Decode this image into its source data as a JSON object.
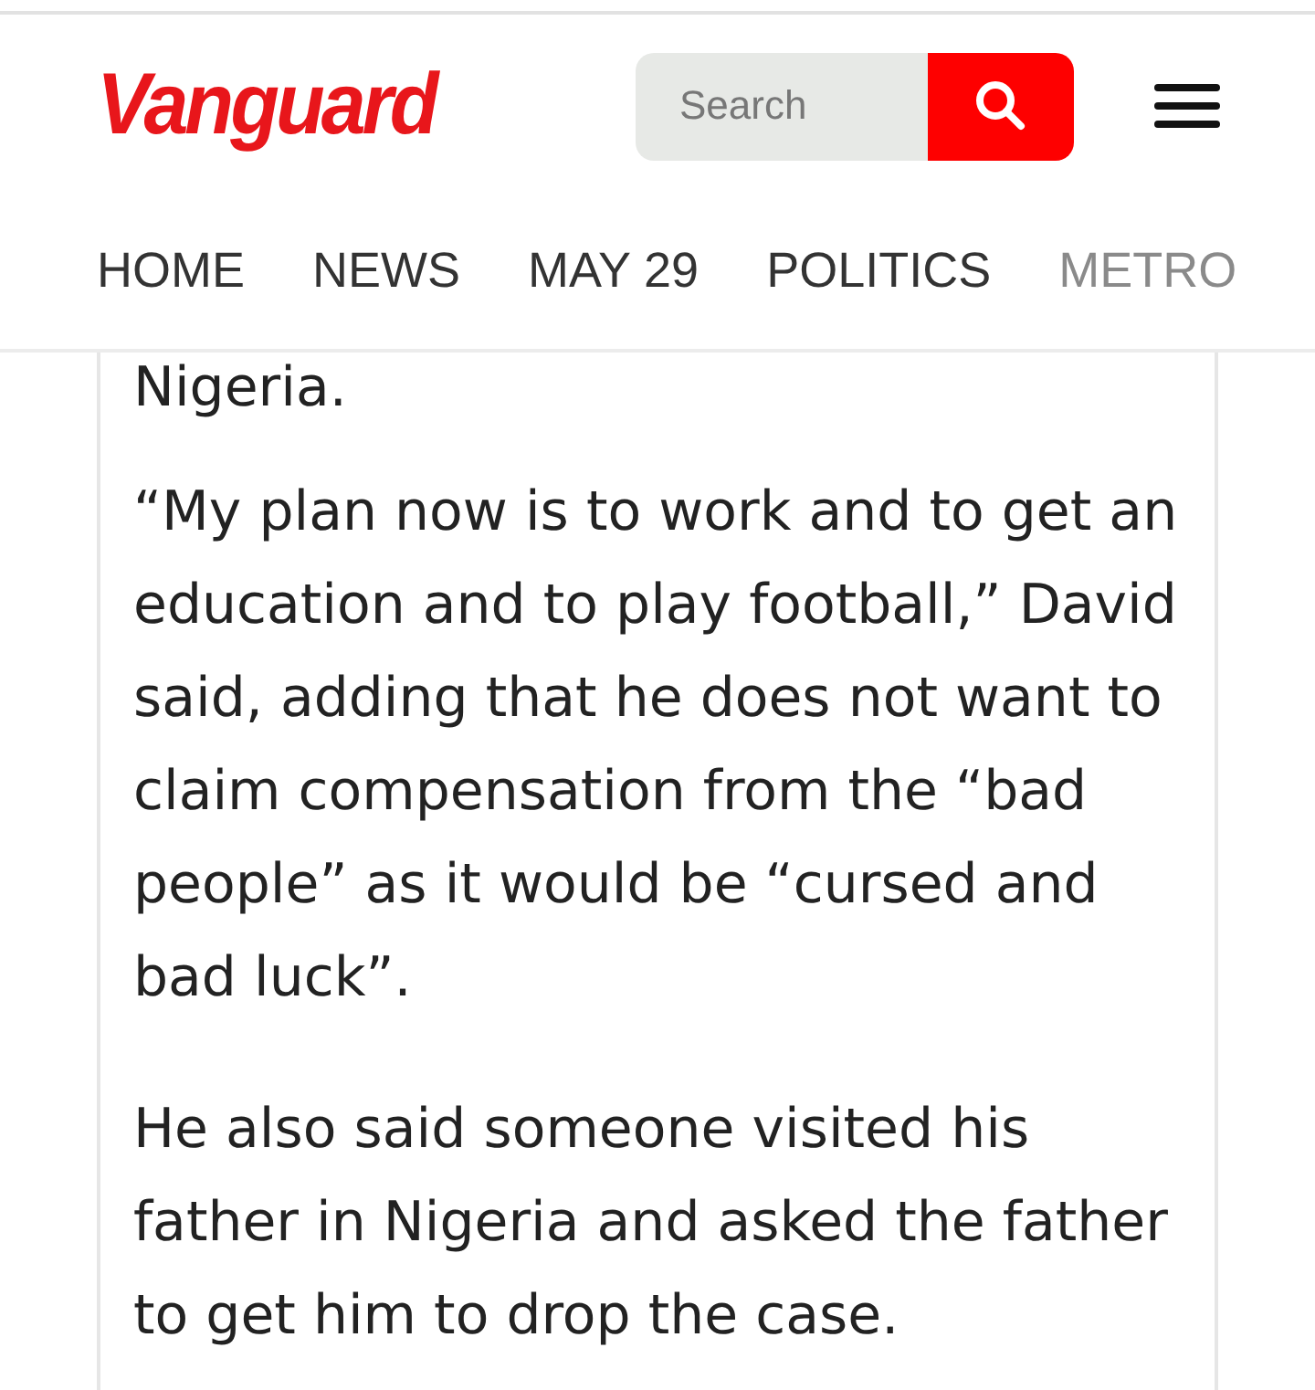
{
  "header": {
    "logo": "Vanguard",
    "search": {
      "placeholder": "Search"
    }
  },
  "nav": [
    {
      "label": "HOME",
      "faded": false
    },
    {
      "label": "NEWS",
      "faded": false
    },
    {
      "label": "MAY 29",
      "faded": false
    },
    {
      "label": "POLITICS",
      "faded": false
    },
    {
      "label": "METRO",
      "faded": true
    }
  ],
  "article": {
    "paragraphs": [
      "Nigeria.",
      "“My plan now is to work and to get an education and to play football,” David said, adding that he does not want to claim compensation from the “bad people” as it would be “cursed and bad luck”.",
      "He also said someone visited his father in Nigeria and asked the father to get him to drop the case."
    ]
  }
}
